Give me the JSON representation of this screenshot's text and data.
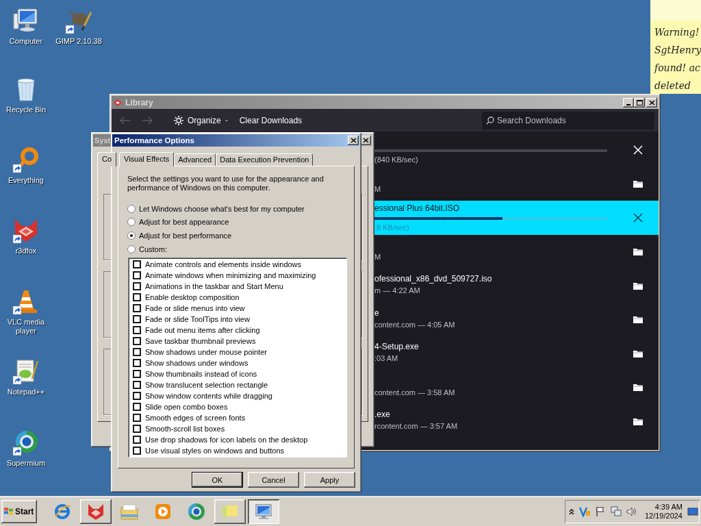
{
  "desktop_icons": [
    {
      "label": "Computer"
    },
    {
      "label": "GIMP 2.10.38"
    },
    {
      "label": "Recycle Bin"
    },
    {
      "label": "Everything"
    },
    {
      "label": "r3dfox"
    },
    {
      "label": "VLC media player"
    },
    {
      "label": "Notepad++"
    },
    {
      "label": "Supermium"
    }
  ],
  "sticky_note": {
    "lines": [
      "Warning!",
      "SgtHenry",
      "found! ac",
      "deleted"
    ]
  },
  "library": {
    "title": "Library",
    "toolbar": {
      "organize": "Organize",
      "clear_downloads": "Clear Downloads",
      "search": {
        "placeholder": "Search Downloads"
      }
    },
    "downloads": [
      {
        "kind": "active",
        "selected": false,
        "status": "(840 KB/sec)"
      },
      {
        "kind": "done",
        "selected": false,
        "status": "M"
      },
      {
        "kind": "active",
        "selected": true,
        "name": "essional Plus 64bit.ISO",
        "level": 0.55,
        "status": ".8 KB/sec)"
      },
      {
        "kind": "done",
        "selected": false,
        "status": "M"
      },
      {
        "kind": "done",
        "selected": false,
        "name": "ofessional_x86_dvd_509727.iso",
        "status": "m — 4:22 AM"
      },
      {
        "kind": "done",
        "selected": false,
        "name": "e",
        "status": "content.com — 4:05 AM"
      },
      {
        "kind": "done",
        "selected": false,
        "name": "4-Setup.exe",
        "status": ":03 AM"
      },
      {
        "kind": "done",
        "selected": false,
        "status": "content.com — 3:58 AM"
      },
      {
        "kind": "done",
        "selected": false,
        "name": ".exe",
        "status": "rcontent.com — 3:57 AM"
      }
    ]
  },
  "system_properties": {
    "title": "Syst",
    "tabs": [
      {
        "label": "Co",
        "selected": true
      }
    ]
  },
  "performance_options": {
    "title": "Performance Options",
    "tabs": [
      {
        "label": "Visual Effects",
        "selected": true
      },
      {
        "label": "Advanced",
        "selected": false
      },
      {
        "label": "Data Execution Prevention",
        "selected": false
      }
    ],
    "intro": "Select the settings you want to use for the appearance and performance of Windows on this computer.",
    "options": [
      {
        "label": "Let Windows choose what's best for my computer",
        "selected": false
      },
      {
        "label": "Adjust for best appearance",
        "selected": false
      },
      {
        "label": "Adjust for best performance",
        "selected": true
      },
      {
        "label": "Custom:",
        "selected": false
      }
    ],
    "effects": [
      {
        "label": "Animate controls and elements inside windows",
        "checked": false
      },
      {
        "label": "Animate windows when minimizing and maximizing",
        "checked": false
      },
      {
        "label": "Animations in the taskbar and Start Menu",
        "checked": false
      },
      {
        "label": "Enable desktop composition",
        "checked": false
      },
      {
        "label": "Fade or slide menus into view",
        "checked": false
      },
      {
        "label": "Fade or slide ToolTips into view",
        "checked": false
      },
      {
        "label": "Fade out menu items after clicking",
        "checked": false
      },
      {
        "label": "Save taskbar thumbnail previews",
        "checked": false
      },
      {
        "label": "Show shadows under mouse pointer",
        "checked": false
      },
      {
        "label": "Show shadows under windows",
        "checked": false
      },
      {
        "label": "Show thumbnails instead of icons",
        "checked": false
      },
      {
        "label": "Show translucent selection rectangle",
        "checked": false
      },
      {
        "label": "Show window contents while dragging",
        "checked": false
      },
      {
        "label": "Slide open combo boxes",
        "checked": false
      },
      {
        "label": "Smooth edges of screen fonts",
        "checked": false
      },
      {
        "label": "Smooth-scroll list boxes",
        "checked": false
      },
      {
        "label": "Use drop shadows for icon labels on the desktop",
        "checked": false
      },
      {
        "label": "Use visual styles on windows and buttons",
        "checked": false
      }
    ],
    "buttons": [
      "OK",
      "Cancel",
      "Apply"
    ]
  },
  "taskbar": {
    "start": "Start",
    "apps": [
      {
        "open": false,
        "selected": false
      },
      {
        "open": true,
        "selected": false
      },
      {
        "open": false,
        "selected": false
      },
      {
        "open": false,
        "selected": false
      },
      {
        "open": false,
        "selected": false
      },
      {
        "open": true,
        "selected": false
      },
      {
        "open": true,
        "selected": true
      }
    ],
    "clock": {
      "time": "4:39 AM",
      "date": "12/19/2024"
    }
  }
}
